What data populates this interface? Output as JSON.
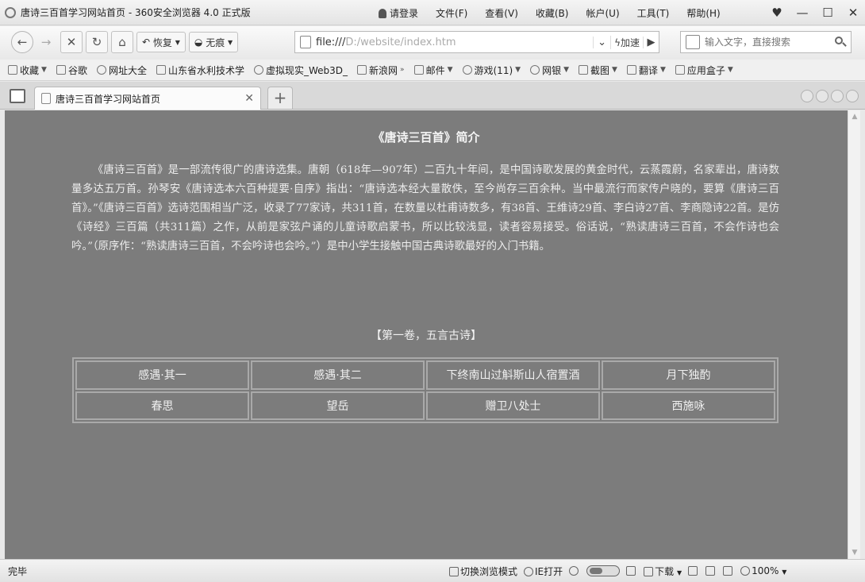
{
  "window": {
    "title": "唐诗三百首学习网站首页 - 360安全浏览器 4.0 正式版",
    "menus": [
      "请登录",
      "文件(F)",
      "查看(V)",
      "收藏(B)",
      "帐户(U)",
      "工具(T)",
      "帮助(H)"
    ],
    "controls": {
      "minimize": "—",
      "maximize": "☐",
      "close": "✕"
    }
  },
  "toolbar": {
    "back": "←",
    "forward": "→",
    "stop": "✕",
    "refresh": "↻",
    "home": "⌂",
    "restore_label": "恢复",
    "trace_label": "无痕",
    "address_protocol": "file:///",
    "address_path": "D:/website/index.htm",
    "speed_label": "加速",
    "go": "▶",
    "search_placeholder": "输入文字，直接搜索"
  },
  "bookmarks": [
    {
      "label": "收藏",
      "dropdown": true
    },
    {
      "label": "谷歌",
      "dropdown": false
    },
    {
      "label": "网址大全",
      "dropdown": false
    },
    {
      "label": "山东省水利技术学",
      "dropdown": false
    },
    {
      "label": "虚拟现实_Web3D_",
      "dropdown": false
    },
    {
      "label": "新浪网",
      "dropdown": false
    },
    {
      "label": "邮件",
      "dropdown": true
    },
    {
      "label": "游戏(11)",
      "dropdown": true
    },
    {
      "label": "网银",
      "dropdown": true
    },
    {
      "label": "截图",
      "dropdown": true
    },
    {
      "label": "翻译",
      "dropdown": true
    },
    {
      "label": "应用盒子",
      "dropdown": true
    }
  ],
  "tabs": {
    "active_title": "唐诗三百首学习网站首页",
    "close": "✕",
    "new": "+"
  },
  "page": {
    "heading": "《唐诗三百首》简介",
    "intro": "《唐诗三百首》是一部流传很广的唐诗选集。唐朝（618年—907年）二百九十年间，是中国诗歌发展的黄金时代，云蒸霞蔚，名家辈出，唐诗数量多达五万首。孙琴安《唐诗选本六百种提要·自序》指出：“唐诗选本经大量散佚，至今尚存三百余种。当中最流行而家传户晓的，要算《唐诗三百首》。”《唐诗三百首》选诗范围相当广泛，收录了77家诗，共311首，在数量以杜甫诗数多，有38首、王维诗29首、李白诗27首、李商隐诗22首。是仿《诗经》三百篇（共311篇）之作，从前是家弦户诵的儿童诗歌启蒙书，所以比较浅显，读者容易接受。俗话说，“熟读唐诗三百首，不会作诗也会吟。”（原序作：“熟读唐诗三百首，不会吟诗也会吟。”）是中小学生接触中国古典诗歌最好的入门书籍。",
    "volume_title": "【第一卷，五言古诗】",
    "poems": [
      [
        "感遇·其一",
        "感遇·其二",
        "下终南山过斛斯山人宿置酒",
        "月下独酌"
      ],
      [
        "春思",
        "望岳",
        "赠卫八处士",
        "西施咏"
      ]
    ]
  },
  "statusbar": {
    "status": "完毕",
    "switch_mode": "切换浏览模式",
    "ie_open": "IE打开",
    "download": "下载",
    "zoom": "100%"
  }
}
